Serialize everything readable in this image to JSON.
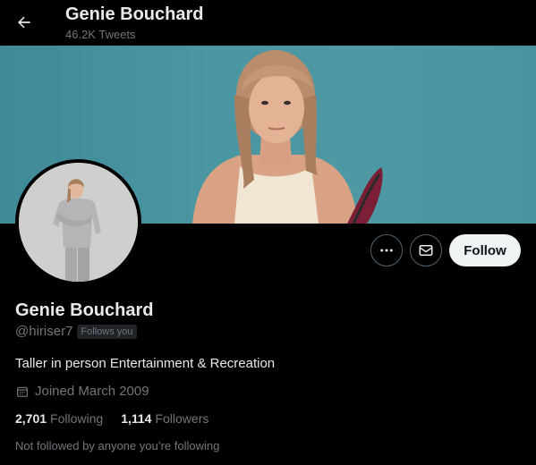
{
  "header": {
    "title": "Genie Bouchard",
    "tweet_count": "46.2K Tweets",
    "back_icon": "arrow-left-icon"
  },
  "profile": {
    "name": "Genie Bouchard",
    "handle": "@hiriser7",
    "follows_you": "Follows you",
    "bio": "Taller in person Entertainment & Recreation",
    "joined": "Joined March 2009",
    "following_count": "2,701",
    "following_label": "Following",
    "followers_count": "1,114",
    "followers_label": "Followers",
    "mutuals_note": "Not followed by anyone you’re following"
  },
  "actions": {
    "more_icon": "more-icon",
    "message_icon": "mail-icon",
    "follow_label": "Follow"
  },
  "colors": {
    "background": "#000000",
    "banner": "#4a96a2",
    "follow_button_bg": "#eff3f4",
    "secondary_text": "#71767b"
  }
}
